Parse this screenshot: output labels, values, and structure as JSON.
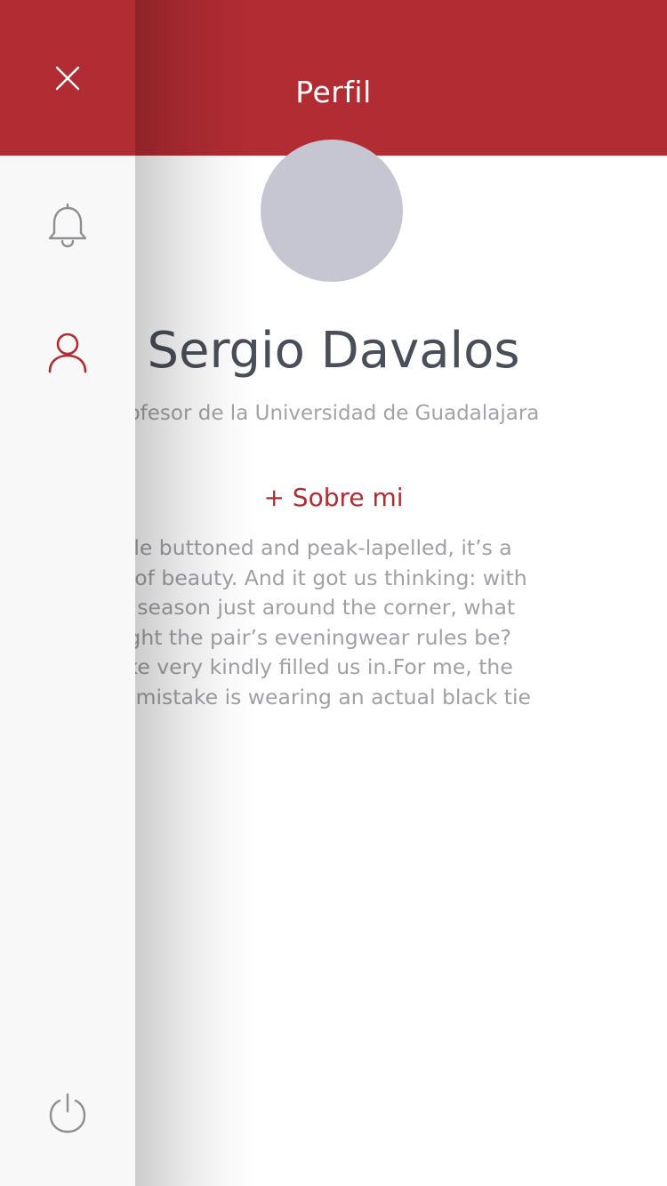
{
  "header": {
    "title": "Perfil"
  },
  "profile": {
    "name": "Sergio Davalos",
    "subtitle": "ofesor de la Universidad de Guadalajara",
    "about_link": "+ Sobre mi",
    "about_lines": [
      "ingle buttoned and peak-lapelled, it’s a",
      "ng of beauty. And it got us thinking: with",
      "rty season just around the corner, what",
      "might the pair’s eveningwear rules be?",
      "Luke very kindly filled us in.For me, the",
      "rst mistake is wearing an actual black tie"
    ]
  },
  "drawer": {
    "items": [
      {
        "icon": "close-icon"
      },
      {
        "icon": "bell-icon"
      },
      {
        "icon": "user-icon",
        "active": true
      },
      {
        "icon": "power-icon"
      }
    ]
  },
  "colors": {
    "brand_red": "#b22c33",
    "drawer_bg": "#f8f8f8",
    "icon_gray": "#8e8e93",
    "avatar_placeholder": "#c6c6d3",
    "name_text": "#4a4e58",
    "body_text": "#a0a0a6"
  }
}
